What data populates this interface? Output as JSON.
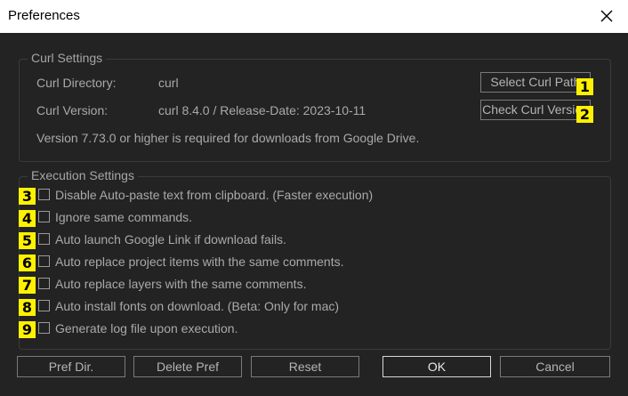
{
  "window": {
    "title": "Preferences"
  },
  "curl_settings": {
    "group_title": "Curl Settings",
    "directory_label": "Curl Directory:",
    "directory_value": "curl",
    "version_label": "Curl Version:",
    "version_value": "curl 8.4.0 / Release-Date: 2023-10-11",
    "note": "Version 7.73.0 or higher is required for downloads from Google Drive.",
    "select_path_button": "Select Curl Path",
    "check_version_button": "Check Curl Version"
  },
  "execution_settings": {
    "group_title": "Execution Settings",
    "options": [
      {
        "label": "Disable Auto-paste text from clipboard. (Faster execution)",
        "checked": false
      },
      {
        "label": "Ignore same commands.",
        "checked": false
      },
      {
        "label": "Auto launch Google Link if download fails.",
        "checked": false
      },
      {
        "label": "Auto replace project items with the same comments.",
        "checked": false
      },
      {
        "label": "Auto replace layers with the same comments.",
        "checked": false
      },
      {
        "label": "Auto install fonts on download. (Beta: Only for mac)",
        "checked": false
      },
      {
        "label": "Generate log file upon execution.",
        "checked": false
      }
    ]
  },
  "footer": {
    "pref_dir": "Pref Dir.",
    "delete_pref": "Delete Pref",
    "reset": "Reset",
    "ok": "OK",
    "cancel": "Cancel"
  },
  "annotations": [
    "1",
    "2",
    "3",
    "4",
    "5",
    "6",
    "7",
    "8",
    "9"
  ],
  "colors": {
    "background": "#232323",
    "text": "#a9a9a9",
    "annotation": "#fff200"
  }
}
